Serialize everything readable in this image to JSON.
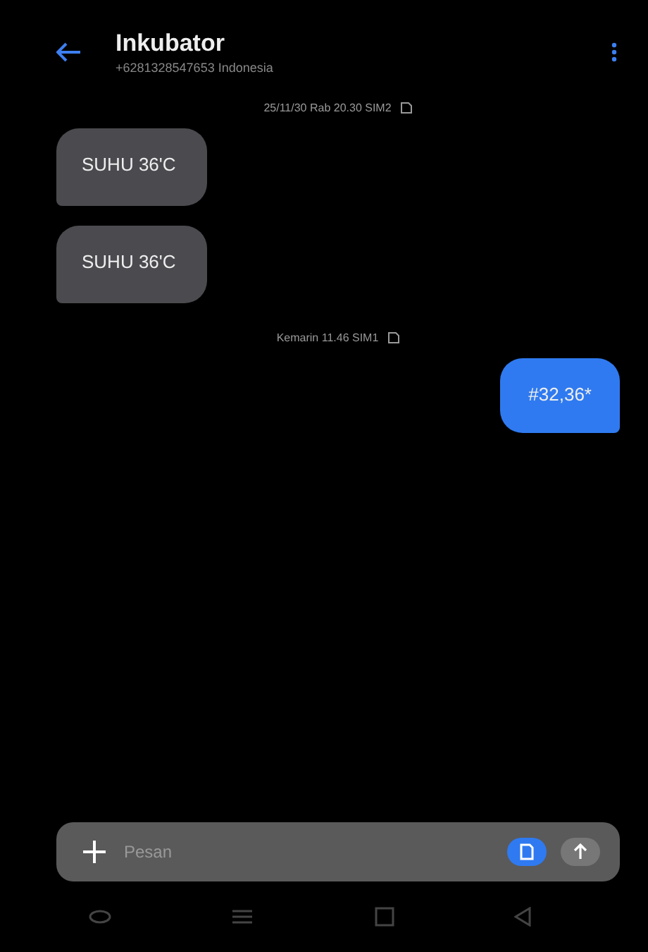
{
  "header": {
    "title": "Inkubator",
    "subtitle": "+6281328547653 Indonesia"
  },
  "messages": [
    {
      "kind": "date",
      "text": "25/11/30 Rab 20.30 SIM2"
    },
    {
      "kind": "incoming",
      "text": "SUHU 36'C"
    },
    {
      "kind": "incoming",
      "text": "SUHU 36'C"
    },
    {
      "kind": "date",
      "text": "Kemarin 11.46 SIM1"
    },
    {
      "kind": "outgoing",
      "text": "#32,36*"
    }
  ],
  "composer": {
    "placeholder": "Pesan"
  }
}
